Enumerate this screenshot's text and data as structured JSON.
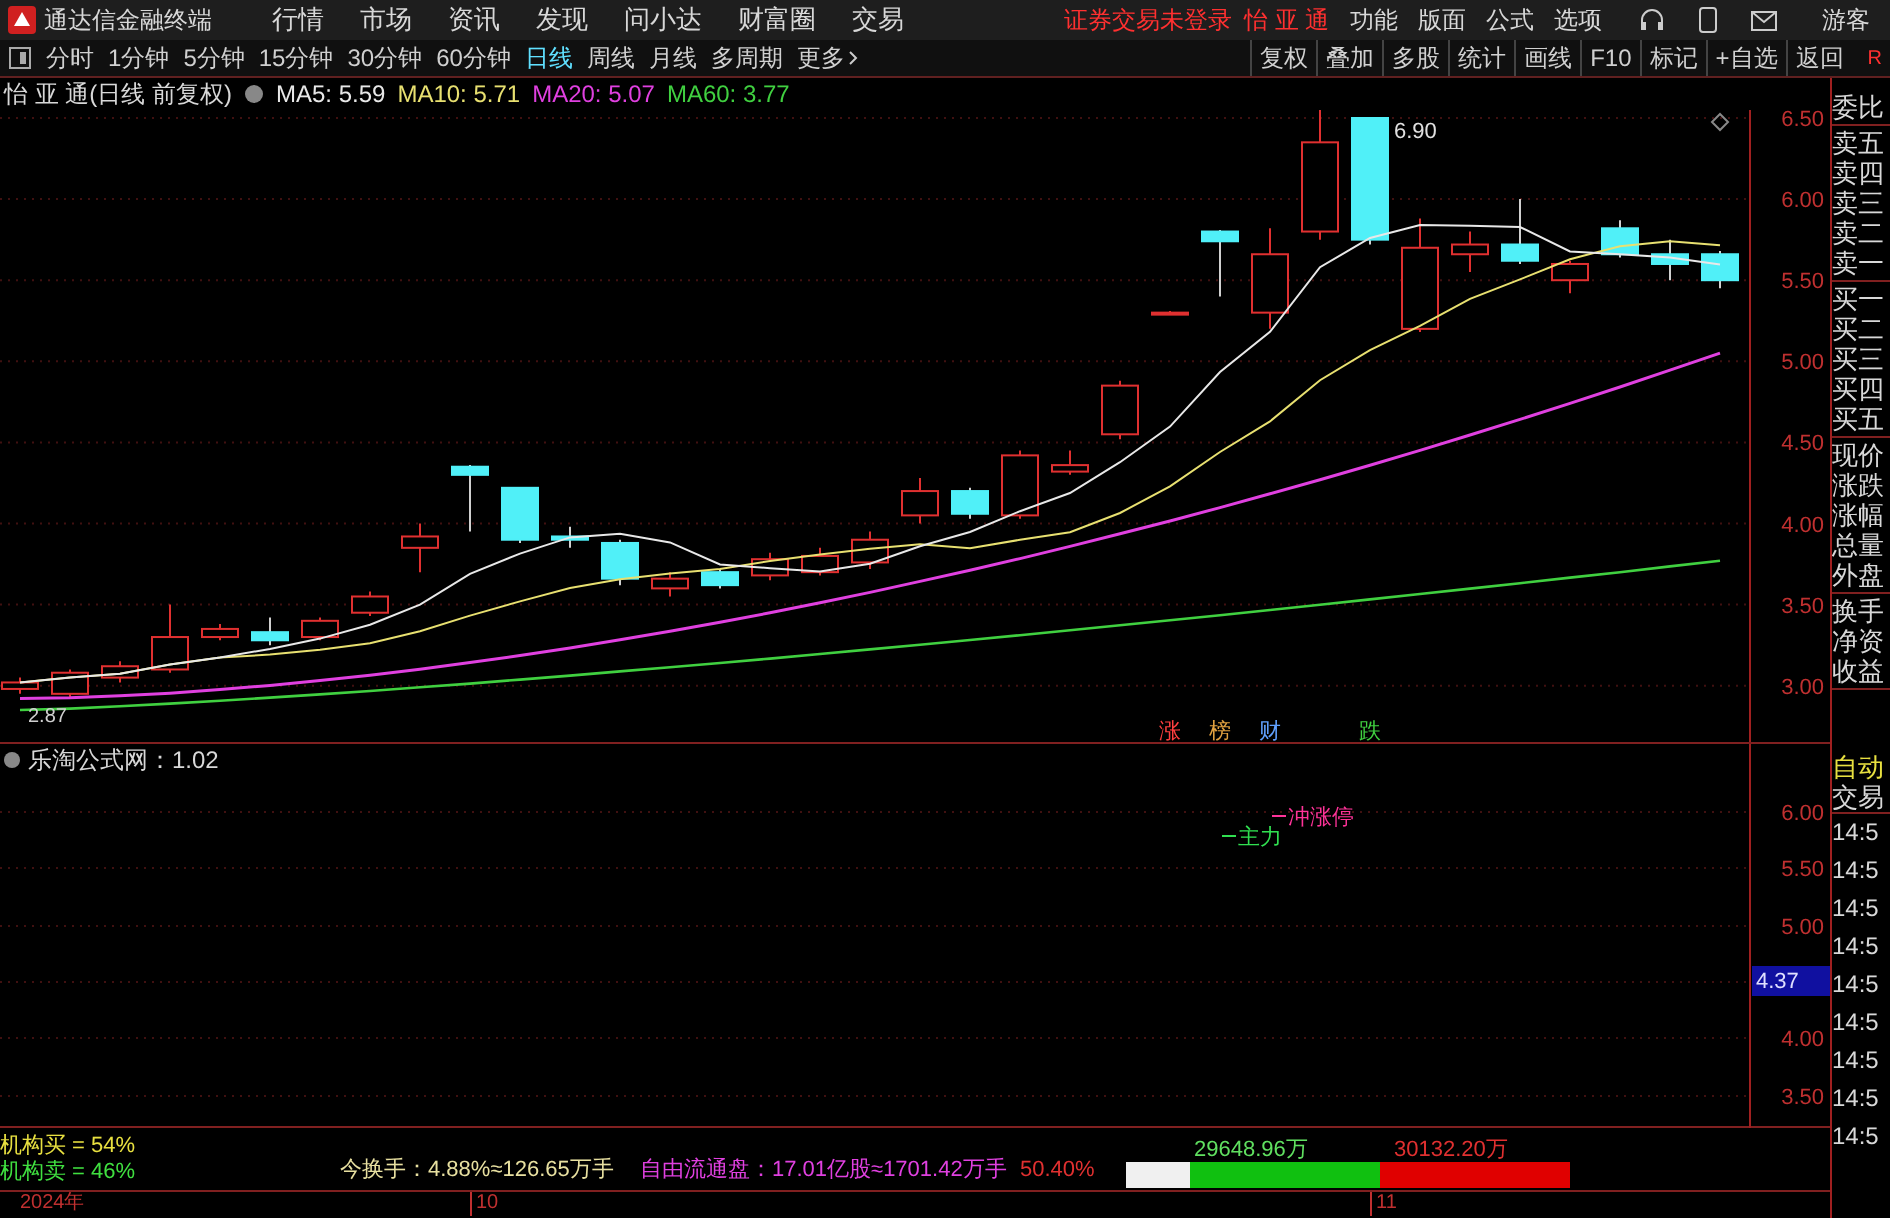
{
  "top_bar": {
    "app_title": "通达信金融终端",
    "menu": [
      "行情",
      "市场",
      "资讯",
      "发现",
      "问小达",
      "财富圈",
      "交易"
    ],
    "status": "证券交易未登录",
    "stock": "怡 亚 通",
    "tools": [
      "功能",
      "版面",
      "公式",
      "选项"
    ],
    "user": "游客"
  },
  "toolbar": {
    "periods": [
      {
        "label": "分时",
        "selected": false
      },
      {
        "label": "1分钟",
        "selected": false
      },
      {
        "label": "5分钟",
        "selected": false
      },
      {
        "label": "15分钟",
        "selected": false
      },
      {
        "label": "30分钟",
        "selected": false
      },
      {
        "label": "60分钟",
        "selected": false
      },
      {
        "label": "日线",
        "selected": true
      },
      {
        "label": "周线",
        "selected": false
      },
      {
        "label": "月线",
        "selected": false
      },
      {
        "label": "多周期",
        "selected": false
      }
    ],
    "more": "更多",
    "actions": [
      "复权",
      "叠加",
      "多股",
      "统计",
      "画线",
      "F10",
      "标记",
      "+自选",
      "返回"
    ],
    "corner": "R"
  },
  "main_chart": {
    "title": "怡 亚 通(日线 前复权)",
    "ma": [
      {
        "label": "MA5: 5.59",
        "color": "#e8e8e8"
      },
      {
        "label": "MA10: 5.71",
        "color": "#e8e070"
      },
      {
        "label": "MA20: 5.07",
        "color": "#e040e0"
      },
      {
        "label": "MA60: 3.77",
        "color": "#40d040"
      }
    ],
    "price_labels": [
      "6.50",
      "6.00",
      "5.50",
      "5.00",
      "4.50",
      "4.00",
      "3.50",
      "3.00"
    ],
    "high_label": "6.90",
    "low_label": "2.87",
    "markers": [
      {
        "text": "涨",
        "color": "#ff4040"
      },
      {
        "text": "榜",
        "color": "#e0a040"
      },
      {
        "text": "财",
        "color": "#60a0ff"
      },
      {
        "text": "跌",
        "color": "#40d040"
      }
    ]
  },
  "quote_panel": {
    "groups": [
      {
        "items": [
          "委比"
        ]
      },
      {
        "items": [
          "卖五",
          "卖四",
          "卖三",
          "卖二",
          "卖一"
        ]
      },
      {
        "items": [
          "买一",
          "买二",
          "买三",
          "买四",
          "买五"
        ]
      },
      {
        "items": [
          "现价",
          "涨跌",
          "涨幅",
          "总量",
          "外盘"
        ]
      },
      {
        "items": [
          "换手",
          "净资",
          "收益"
        ]
      }
    ]
  },
  "indicator": {
    "title": "乐淘公式网：1.02",
    "labels": [
      {
        "text": "主力",
        "color": "#30e050"
      },
      {
        "text": "冲涨停",
        "color": "#ff3399"
      }
    ],
    "axis": [
      "6.00",
      "5.50",
      "5.00",
      "4.00",
      "3.50"
    ],
    "current": "4.37"
  },
  "trade_panel": {
    "header": "自动",
    "subheader": "交易",
    "times": [
      "14:5",
      "14:5",
      "14:5",
      "14:5",
      "14:5",
      "14:5",
      "14:5",
      "14:5",
      "14:5"
    ]
  },
  "bottom": {
    "buy": "机构买 = 54%",
    "sell": "机构卖 = 46%",
    "turnover": "今换手：4.88%≈126.65万手",
    "float": "自由流通盘：17.01亿股≈1701.42万手",
    "ratio": "50.40%",
    "green_value": "29648.96万",
    "red_value": "30132.20万",
    "bar_segments": [
      {
        "color": "#f0f0f0"
      },
      {
        "color": "#10c010"
      },
      {
        "color": "#e00000"
      }
    ]
  },
  "date_axis": [
    "2024年",
    "10",
    "11"
  ]
}
